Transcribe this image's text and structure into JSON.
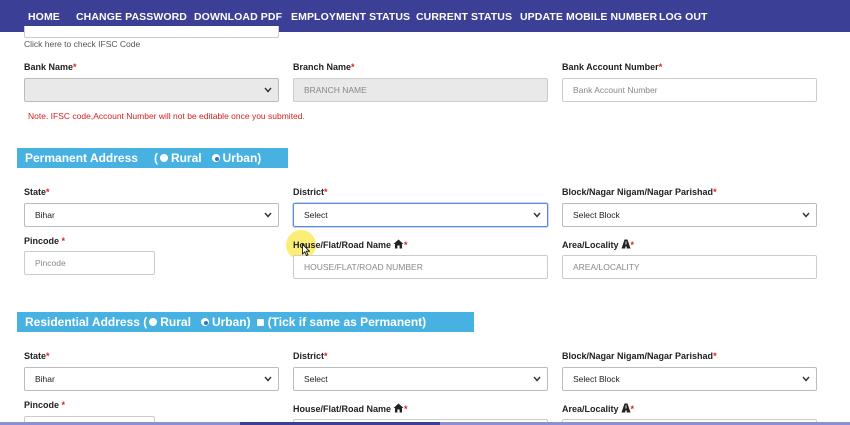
{
  "nav": {
    "items": [
      "HOME",
      "CHANGE PASSWORD",
      "DOWNLOAD PDF",
      "EMPLOYMENT STATUS",
      "CURRENT STATUS",
      "UPDATE MOBILE NUMBER",
      "LOG OUT"
    ]
  },
  "bank": {
    "ifsc_hint": "Click here to check IFSC Code",
    "bank_name_label": "Bank Name",
    "bank_name_value": "",
    "branch_name_label": "Branch Name",
    "branch_name_placeholder": "BRANCH NAME",
    "account_label": "Bank Account Number",
    "account_placeholder": "Bank Account Number",
    "note": "Note. IFSC code,Account Number will not be editable once you submited."
  },
  "permanent": {
    "title": "Permanent Address",
    "open_paren": "(",
    "rural": "Rural",
    "urban": "Urban)",
    "state_label": "State",
    "state_value": "Bihar",
    "district_label": "District",
    "district_value": "Select",
    "block_label": "Block/Nagar Nigam/Nagar Parishad",
    "block_value": "Select Block",
    "pincode_label": "Pincode",
    "pincode_placeholder": "Pincode",
    "house_label": "House/Flat/Road Name",
    "house_placeholder": "HOUSE/FLAT/ROAD NUMBER",
    "area_label": "Area/Locality",
    "area_placeholder": "AREA/LOCALITY"
  },
  "residential": {
    "title": "Residential Address (",
    "rural": "Rural",
    "urban": "Urban)",
    "same_as": "(Tick if same as Permanent)",
    "state_label": "State",
    "state_value": "Bihar",
    "district_label": "District",
    "district_value": "Select",
    "block_label": "Block/Nagar Nigam/Nagar Parishad",
    "block_value": "Select Block",
    "pincode_label": "Pincode",
    "house_label": "House/Flat/Road Name",
    "area_label": "Area/Locality"
  },
  "required_mark": "*",
  "icons": {
    "house": "home-icon",
    "area": "road-icon",
    "chevron": "chevron-down-icon",
    "cursor": "mouse-pointer-icon"
  },
  "colors": {
    "navbar": "#3b3f95",
    "section": "#47b2e1",
    "required": "#e02020",
    "note": "#d42020"
  }
}
